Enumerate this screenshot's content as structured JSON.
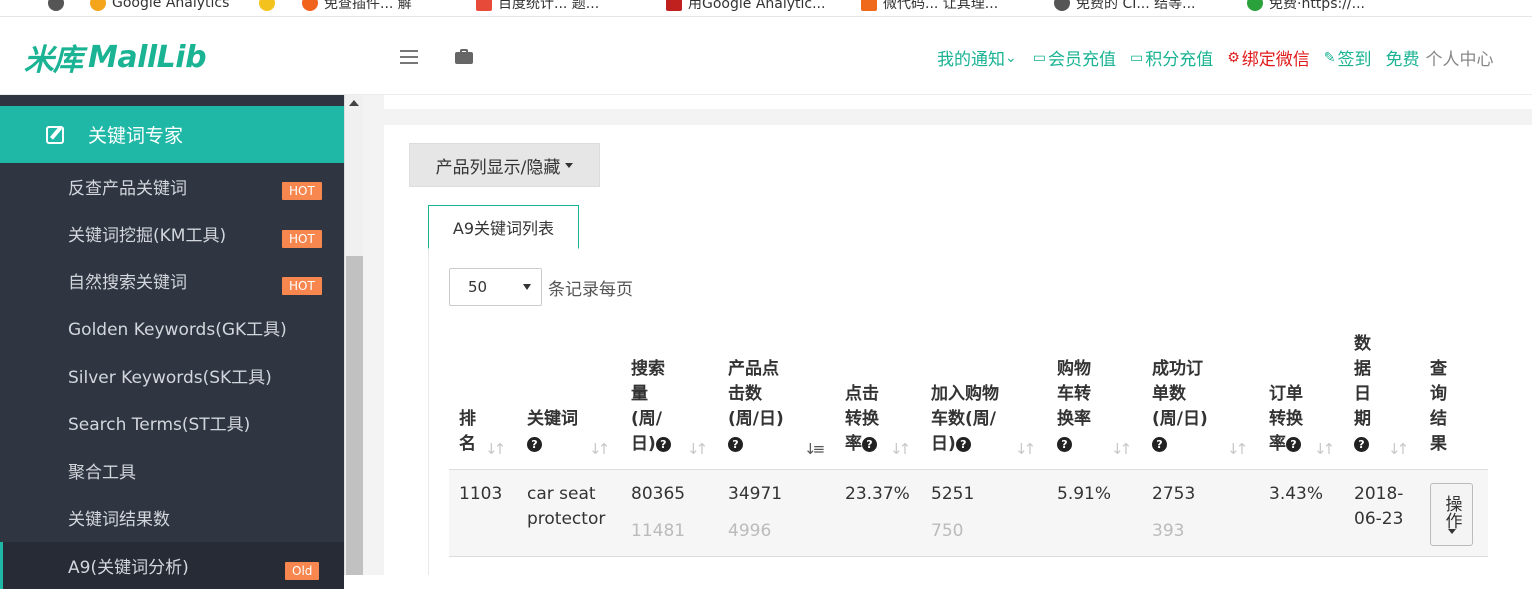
{
  "bookmarks": [
    {
      "label": "Google Analytics",
      "color": "#f4a51c"
    },
    {
      "label": "",
      "color": "#f4c21c"
    },
    {
      "label": "免查插件... 解",
      "color": "#f0641e"
    },
    {
      "label": "百度统计... 题...",
      "color": "#e84a3a"
    },
    {
      "label": "用Google Analytic...",
      "color": "#c0211f"
    },
    {
      "label": "微代码... 让其理...",
      "color": "#f06a1c"
    },
    {
      "label": "免费的 CI... 结等...",
      "color": "#555555"
    },
    {
      "label": "免费·https://...",
      "color": "#2ba13c"
    }
  ],
  "header": {
    "logo_cn": "米库",
    "logo_en": "MallLib",
    "nav": [
      {
        "label": "我的通知",
        "suffix": "⌄"
      },
      {
        "label": "会员充值",
        "prefix": "▭"
      },
      {
        "label": "积分充值",
        "prefix": "▭"
      },
      {
        "label": "绑定微信",
        "prefix": "⚙"
      },
      {
        "label": "签到",
        "prefix": "✎"
      },
      {
        "label": "免费"
      },
      {
        "label": "个人中心"
      }
    ]
  },
  "sidebar": {
    "section": "关键词专家",
    "items": [
      {
        "label": "反查产品关键词",
        "badge": "HOT"
      },
      {
        "label": "关键词挖掘(KM工具)",
        "badge": "HOT"
      },
      {
        "label": "自然搜索关键词",
        "badge": "HOT"
      },
      {
        "label": "Golden Keywords(GK工具)",
        "badge": ""
      },
      {
        "label": "Silver Keywords(SK工具)",
        "badge": ""
      },
      {
        "label": "Search Terms(ST工具)",
        "badge": ""
      },
      {
        "label": "聚合工具",
        "badge": ""
      },
      {
        "label": "关键词结果数",
        "badge": ""
      },
      {
        "label": "A9(关键词分析)",
        "badge": "Old"
      }
    ]
  },
  "main": {
    "column_toggle": "产品列显示/隐藏",
    "tab": "A9关键词列表",
    "page_length": "50",
    "page_length_label": "条记录每页",
    "columns": [
      {
        "lines": [
          "排",
          "名"
        ],
        "help": false
      },
      {
        "lines": [
          "关键词"
        ],
        "help": true
      },
      {
        "lines": [
          "搜索",
          "量",
          "(周/",
          "日)"
        ],
        "help": true
      },
      {
        "lines": [
          "产品点",
          "击数",
          "(周/日)"
        ],
        "help": true
      },
      {
        "lines": [
          "点击",
          "转换",
          "率"
        ],
        "help": true
      },
      {
        "lines": [
          "加入购物",
          "车数(周/",
          "日)"
        ],
        "help": true
      },
      {
        "lines": [
          "购物",
          "车转",
          "换率"
        ],
        "help": true
      },
      {
        "lines": [
          "成功订",
          "单数",
          "(周/日)"
        ],
        "help": true
      },
      {
        "lines": [
          "订单",
          "转换",
          "率"
        ],
        "help": true
      },
      {
        "lines": [
          "数",
          "据",
          "日",
          "期"
        ],
        "help": true
      },
      {
        "lines": [
          "查",
          "询",
          "结",
          "果"
        ],
        "help": false
      }
    ],
    "rows": [
      {
        "rank": "1103",
        "keyword": "car seat protector",
        "search_week": "80365",
        "search_day": "11481",
        "clicks_week": "34971",
        "clicks_day": "4996",
        "click_cvr": "23.37%",
        "cart_week": "5251",
        "cart_day": "750",
        "cart_cvr": "5.91%",
        "orders_week": "2753",
        "orders_day": "393",
        "order_cvr": "3.43%",
        "date": "2018-06-23",
        "action": "操作"
      }
    ]
  }
}
